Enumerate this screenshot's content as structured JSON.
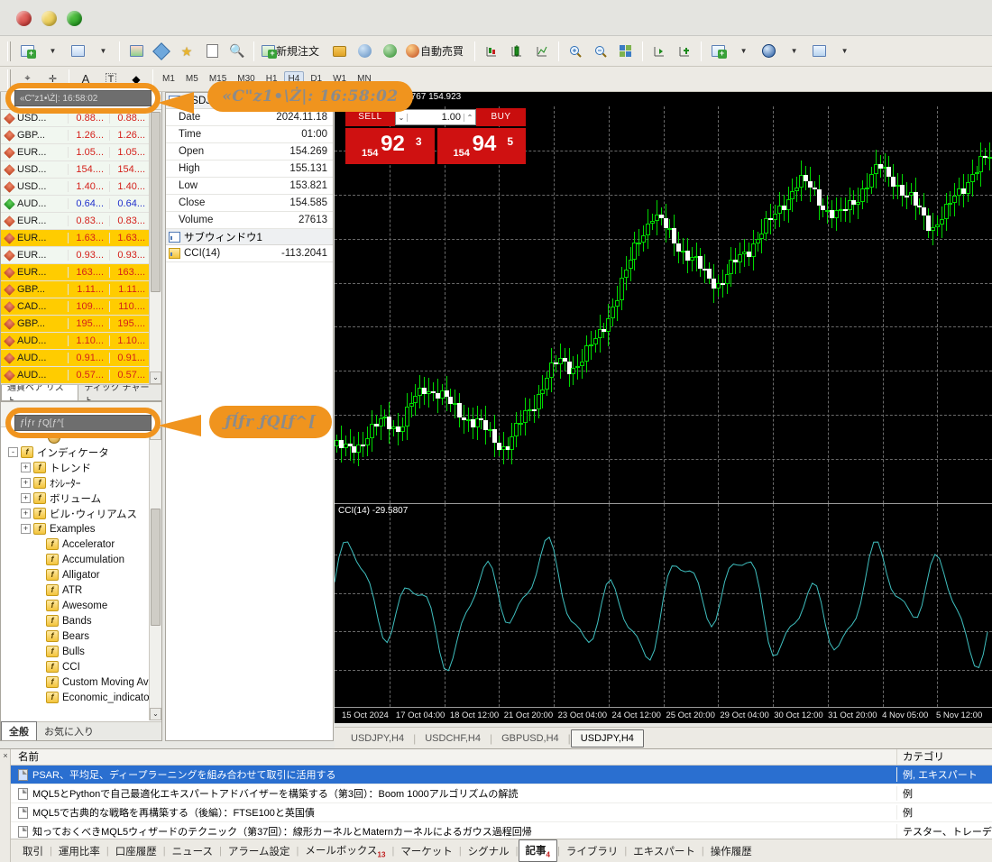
{
  "window": {
    "traffic_lights": [
      "close",
      "minimize",
      "maximize"
    ]
  },
  "toolbar": {
    "new_order_label": "新規注文",
    "autotrading_label": "自動売買",
    "icons": [
      "new-chart-icon",
      "chart-profile-icon",
      "chart-template-icon",
      "crosshair-icon",
      "favorites-icon",
      "data-window-icon",
      "navigator-icon",
      "new-order-icon",
      "algo-icon",
      "strategy-tester-icon",
      "signals-icon",
      "autotrading-icon",
      "bar-chart-icon",
      "candlestick-icon",
      "line-chart-icon",
      "zoom-in-icon",
      "zoom-out-icon",
      "tile-windows-icon",
      "shift-end-icon",
      "auto-scroll-icon",
      "indicators-icon",
      "period-icon",
      "objects-icon"
    ]
  },
  "toolbar2": {
    "text_tool": "A",
    "label_tool": "T",
    "timeframes": [
      "M1",
      "M5",
      "M15",
      "M30",
      "H1",
      "H4",
      "D1",
      "W1",
      "MN"
    ],
    "active_timeframe": "H4"
  },
  "market_watch": {
    "title_search_value": "«C\"z1•\\Ż|: 16:58:02",
    "tabs": [
      "通貨ペア リスト",
      "ティック チャート"
    ],
    "active_tab": "通貨ペア リスト",
    "columns": [
      "シンボル",
      "Bid",
      "Ask"
    ],
    "rows": [
      {
        "symbol": "USD...",
        "bid": "0.88...",
        "ask": "0.88...",
        "dir": "down",
        "color": "red",
        "highlight": false
      },
      {
        "symbol": "GBP...",
        "bid": "1.26...",
        "ask": "1.26...",
        "dir": "down",
        "color": "red",
        "highlight": false
      },
      {
        "symbol": "EUR...",
        "bid": "1.05...",
        "ask": "1.05...",
        "dir": "down",
        "color": "red",
        "highlight": false
      },
      {
        "symbol": "USD...",
        "bid": "154....",
        "ask": "154....",
        "dir": "down",
        "color": "red",
        "highlight": false
      },
      {
        "symbol": "USD...",
        "bid": "1.40...",
        "ask": "1.40...",
        "dir": "down",
        "color": "red",
        "highlight": false
      },
      {
        "symbol": "AUD...",
        "bid": "0.64...",
        "ask": "0.64...",
        "dir": "up",
        "color": "blue",
        "highlight": false
      },
      {
        "symbol": "EUR...",
        "bid": "0.83...",
        "ask": "0.83...",
        "dir": "down",
        "color": "red",
        "highlight": false
      },
      {
        "symbol": "EUR...",
        "bid": "1.63...",
        "ask": "1.63...",
        "dir": "down",
        "color": "red",
        "highlight": true
      },
      {
        "symbol": "EUR...",
        "bid": "0.93...",
        "ask": "0.93...",
        "dir": "down",
        "color": "red",
        "highlight": false
      },
      {
        "symbol": "EUR...",
        "bid": "163....",
        "ask": "163....",
        "dir": "down",
        "color": "red",
        "highlight": true
      },
      {
        "symbol": "GBP...",
        "bid": "1.11...",
        "ask": "1.11...",
        "dir": "down",
        "color": "red",
        "highlight": true
      },
      {
        "symbol": "CAD...",
        "bid": "109....",
        "ask": "110....",
        "dir": "down",
        "color": "red",
        "highlight": true
      },
      {
        "symbol": "GBP...",
        "bid": "195....",
        "ask": "195....",
        "dir": "down",
        "color": "red",
        "highlight": true
      },
      {
        "symbol": "AUD...",
        "bid": "1.10...",
        "ask": "1.10...",
        "dir": "down",
        "color": "red",
        "highlight": true
      },
      {
        "symbol": "AUD...",
        "bid": "0.91...",
        "ask": "0.91...",
        "dir": "down",
        "color": "red",
        "highlight": true
      },
      {
        "symbol": "AUD...",
        "bid": "0.57...",
        "ask": "0.57...",
        "dir": "down",
        "color": "red",
        "highlight": true
      }
    ]
  },
  "navigator": {
    "search_value": "ƒĺƒr ƒQ[ƒ^[",
    "tabs": [
      "全般",
      "お気に入り"
    ],
    "active_tab": "全般",
    "tree": [
      {
        "label": "インディケータ",
        "indent": 0,
        "expander": "-",
        "icon": "indicator-folder-icon"
      },
      {
        "label": "トレンド",
        "indent": 1,
        "expander": "+",
        "icon": "indicator-folder-icon"
      },
      {
        "label": "ｵｼﾚｰﾀｰ",
        "indent": 1,
        "expander": "+",
        "icon": "indicator-folder-icon"
      },
      {
        "label": "ボリューム",
        "indent": 1,
        "expander": "+",
        "icon": "indicator-folder-icon"
      },
      {
        "label": "ビル･ウィリアムス",
        "indent": 1,
        "expander": "+",
        "icon": "indicator-folder-icon"
      },
      {
        "label": "Examples",
        "indent": 1,
        "expander": "+",
        "icon": "indicator-custom-icon"
      },
      {
        "label": "Accelerator",
        "indent": 2,
        "expander": "",
        "icon": "indicator-custom-icon"
      },
      {
        "label": "Accumulation",
        "indent": 2,
        "expander": "",
        "icon": "indicator-custom-icon"
      },
      {
        "label": "Alligator",
        "indent": 2,
        "expander": "",
        "icon": "indicator-custom-icon"
      },
      {
        "label": "ATR",
        "indent": 2,
        "expander": "",
        "icon": "indicator-custom-icon"
      },
      {
        "label": "Awesome",
        "indent": 2,
        "expander": "",
        "icon": "indicator-custom-icon"
      },
      {
        "label": "Bands",
        "indent": 2,
        "expander": "",
        "icon": "indicator-custom-icon"
      },
      {
        "label": "Bears",
        "indent": 2,
        "expander": "",
        "icon": "indicator-custom-icon"
      },
      {
        "label": "Bulls",
        "indent": 2,
        "expander": "",
        "icon": "indicator-custom-icon"
      },
      {
        "label": "CCI",
        "indent": 2,
        "expander": "",
        "icon": "indicator-custom-icon"
      },
      {
        "label": "Custom Moving Av",
        "indent": 2,
        "expander": "",
        "icon": "indicator-custom-icon"
      },
      {
        "label": "Economic_indicato",
        "indent": 2,
        "expander": "",
        "icon": "indicator-custom-icon"
      }
    ]
  },
  "data_window": {
    "symbol_section": "USDJPY,H4",
    "subwindow_section": "サブウィンドウ1",
    "rows": [
      {
        "key": "Date",
        "value": "2024.11.18"
      },
      {
        "key": "Time",
        "value": "01:00"
      },
      {
        "key": "Open",
        "value": "154.269"
      },
      {
        "key": "High",
        "value": "155.131"
      },
      {
        "key": "Low",
        "value": "153.821"
      },
      {
        "key": "Close",
        "value": "154.585"
      },
      {
        "key": "Volume",
        "value": "27613"
      }
    ],
    "indicator_row": {
      "key": "CCI(14)",
      "value": "-113.2041"
    }
  },
  "one_click_trade": {
    "sell_label": "SELL",
    "buy_label": "BUY",
    "volume": "1.00",
    "sell_price": {
      "prefix": "154",
      "big": "92",
      "sup": "3"
    },
    "buy_price": {
      "prefix": "154",
      "big": "94",
      "sup": "5"
    }
  },
  "chart": {
    "header": "767, 155.348 154.767 154.923",
    "cci_label": "CCI(14) -29.5807",
    "tabs": [
      "USDJPY,H4",
      "USDCHF,H4",
      "GBPUSD,H4",
      "USDJPY,H4"
    ],
    "active_tab_index": 3,
    "x_ticks": [
      "15 Oct 2024",
      "17 Oct 04:00",
      "18 Oct 12:00",
      "21 Oct 20:00",
      "23 Oct 04:00",
      "24 Oct 12:00",
      "25 Oct 20:00",
      "29 Oct 04:00",
      "30 Oct 12:00",
      "31 Oct 20:00",
      "4 Nov 05:00",
      "5 Nov 12:00"
    ]
  },
  "terminal": {
    "columns": {
      "name": "名前",
      "category": "カテゴリ"
    },
    "rows": [
      {
        "name": "PSAR、平均足、ディープラーニングを組み合わせて取引に活用する",
        "category": "例, エキスパート",
        "selected": true
      },
      {
        "name": "MQL5とPythonで自己最適化エキスパートアドバイザーを構築する（第3回）：Boom 1000アルゴリズムの解読",
        "category": "例",
        "selected": false
      },
      {
        "name": "MQL5で古典的な戦略を再構築する（後編）：FTSE100と英国債",
        "category": "例",
        "selected": false
      },
      {
        "name": "知っておくべきMQL5ウィザードのテクニック（第37回）：線形カーネルとMaternカーネルによるガウス過程回帰",
        "category": "テスター、トレーディ",
        "selected": false
      }
    ],
    "tabs": [
      {
        "label": "取引",
        "badge": "",
        "active": false
      },
      {
        "label": "運用比率",
        "badge": "",
        "active": false
      },
      {
        "label": "口座履歴",
        "badge": "",
        "active": false
      },
      {
        "label": "ニュース",
        "badge": "",
        "active": false
      },
      {
        "label": "アラーム設定",
        "badge": "",
        "active": false
      },
      {
        "label": "メールボックス",
        "badge": "13",
        "active": false
      },
      {
        "label": "マーケット",
        "badge": "",
        "active": false
      },
      {
        "label": "シグナル",
        "badge": "",
        "active": false
      },
      {
        "label": "記事",
        "badge": "4",
        "active": true
      },
      {
        "label": "ライブラリ",
        "badge": "",
        "active": false
      },
      {
        "label": "エキスパート",
        "badge": "",
        "active": false
      },
      {
        "label": "操作履歴",
        "badge": "",
        "active": false
      }
    ]
  },
  "annotations": {
    "callout_1_text": "«C\"z1•\\Ż|: 16:58:02",
    "callout_2_text": "ƒĺƒr ƒQ[ƒ^[",
    "accent_color": "#f0941e"
  }
}
